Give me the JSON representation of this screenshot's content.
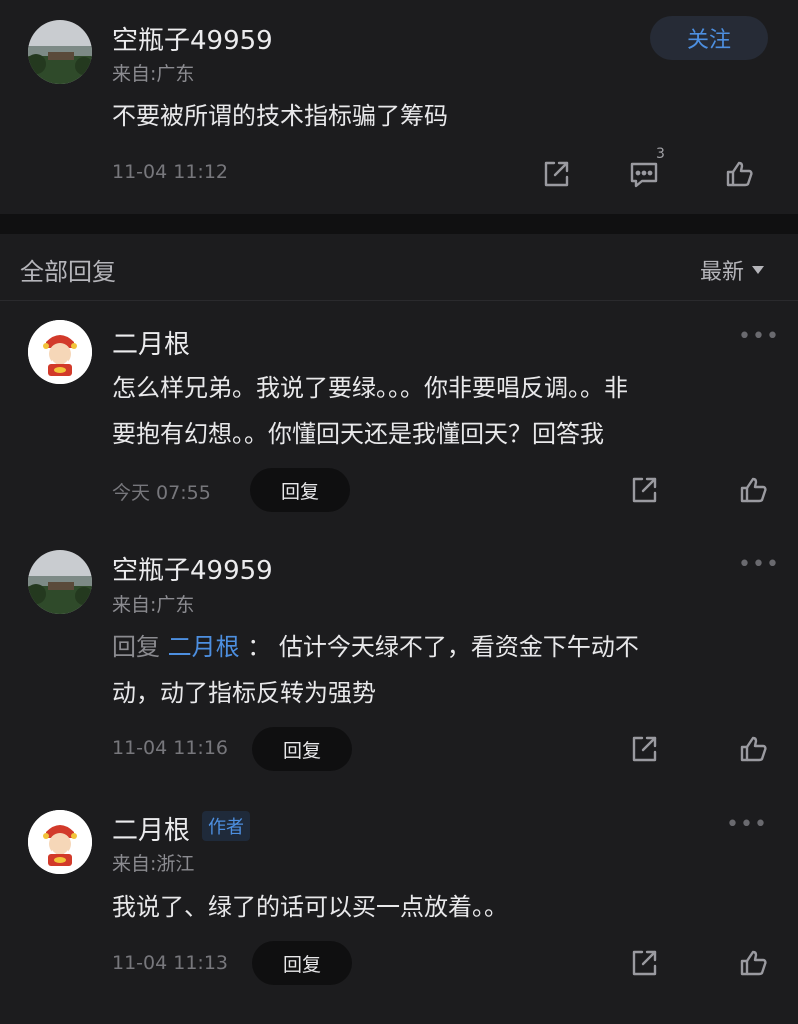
{
  "post": {
    "username": "空瓶子49959",
    "location": "来自:广东",
    "content": "不要被所谓的技术指标骗了筹码",
    "time": "11-04 11:12",
    "follow_label": "关注",
    "comment_count": "3"
  },
  "replies_header": {
    "title": "全部回复",
    "sort_label": "最新"
  },
  "comments": [
    {
      "username": "二月根",
      "line1": "怎么样兄弟。我说了要绿。。。你非要唱反调。。非",
      "line2": "要抱有幻想。。你懂回天还是我懂回天？回答我",
      "time": "今天 07:55",
      "reply_label": "回复",
      "more": "•••"
    },
    {
      "username": "空瓶子49959",
      "location": "来自:广东",
      "reply_prefix": "回复",
      "reply_to": "二月根",
      "reply_colon": "：",
      "line1": "估计今天绿不了，看资金下午动不",
      "line2": "动，动了指标反转为强势",
      "time": "11-04 11:16",
      "reply_label": "回复",
      "more": "•••"
    },
    {
      "username": "二月根",
      "author_tag": "作者",
      "location": "来自:浙江",
      "line1": "我说了、绿了的话可以买一点放着。。",
      "time": "11-04 11:13",
      "reply_label": "回复",
      "more": "•••"
    }
  ],
  "colors": {
    "background": "#1c1c1e",
    "accent": "#4d8fe0",
    "band": "#101011"
  }
}
